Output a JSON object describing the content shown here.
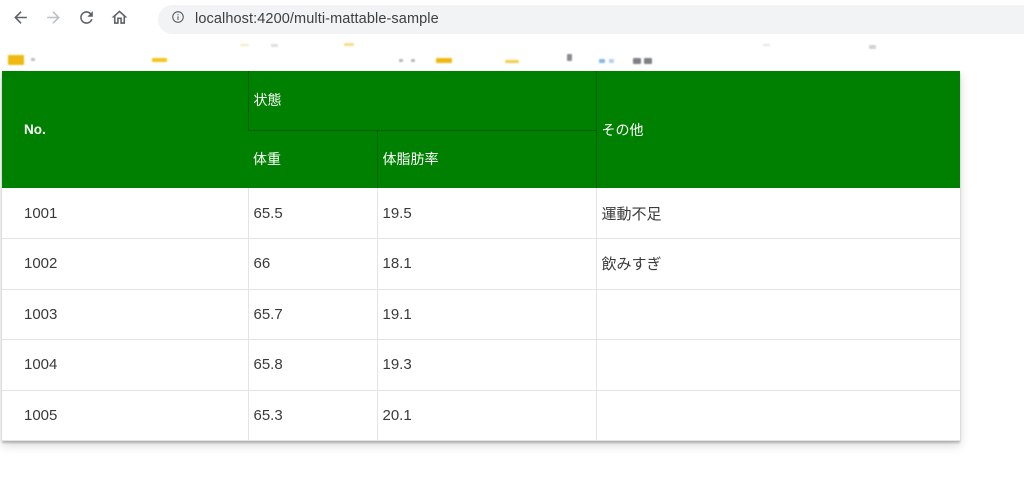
{
  "browser": {
    "url": "localhost:4200/multi-mattable-sample",
    "icons": {
      "back": "arrow-left-icon",
      "forward": "arrow-right-icon",
      "reload": "refresh-icon",
      "home": "home-icon",
      "page_info": "info-circle-icon"
    }
  },
  "table": {
    "header": {
      "no": "No.",
      "status_group": "状態",
      "weight": "体重",
      "body_fat": "体脂肪率",
      "other": "その他"
    },
    "rows": [
      {
        "no": "1001",
        "weight": "65.5",
        "body_fat": "19.5",
        "other": "運動不足"
      },
      {
        "no": "1002",
        "weight": "66",
        "body_fat": "18.1",
        "other": "飲みすぎ"
      },
      {
        "no": "1003",
        "weight": "65.7",
        "body_fat": "19.1",
        "other": ""
      },
      {
        "no": "1004",
        "weight": "65.8",
        "body_fat": "19.3",
        "other": ""
      },
      {
        "no": "1005",
        "weight": "65.3",
        "body_fat": "20.1",
        "other": ""
      }
    ]
  },
  "theme": {
    "header_bg": "#008000",
    "header_text": "#ffffff",
    "row_border": "#e4e4e4",
    "cell_text": "#3a3a3a",
    "pill_bg": "#f1f3f4",
    "url_text": "#3c4043",
    "toolbar_icon": "#5f6368",
    "toolbar_icon_disabled": "#bdc1c6"
  }
}
